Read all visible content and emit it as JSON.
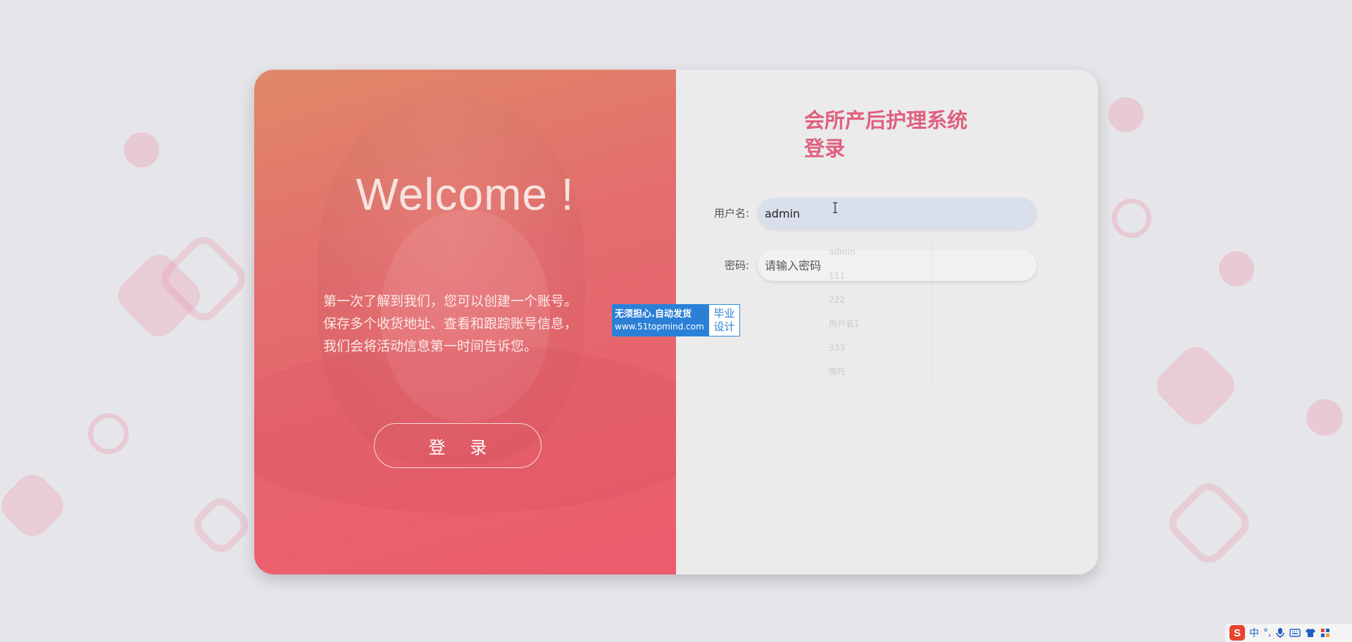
{
  "left_panel": {
    "welcome": "Welcome !",
    "intro_lines": [
      "第一次了解到我们，您可以创建一个账号。",
      "保存多个收货地址、查看和跟踪账号信息，",
      "我们会将活动信息第一时间告诉您。"
    ],
    "login_button": "登 录"
  },
  "right_panel": {
    "title_line1": "会所产后护理系统",
    "title_line2": "登录",
    "username_label": "用户名:",
    "username_value": "admin",
    "password_label": "密码:",
    "password_placeholder": "请输入密码",
    "autocomplete": [
      "admin",
      "111",
      "222",
      "用户名1",
      "333",
      "哪吒"
    ]
  },
  "watermark": {
    "line1": "无须担心.自动发货",
    "line2": "www.51topmind.com",
    "right1": "毕业",
    "right2": "设计"
  },
  "ime_bar": {
    "logo": "S",
    "mode": "中",
    "punct": "°,",
    "items": [
      "mic-icon",
      "keyboard-icon",
      "shirt-icon",
      "grid-icon"
    ]
  },
  "colors": {
    "accent": "#e0607e",
    "panel_gradient_start": "#e08868",
    "panel_gradient_end": "#ec5b6c",
    "badge_blue": "#2b7fd6"
  }
}
